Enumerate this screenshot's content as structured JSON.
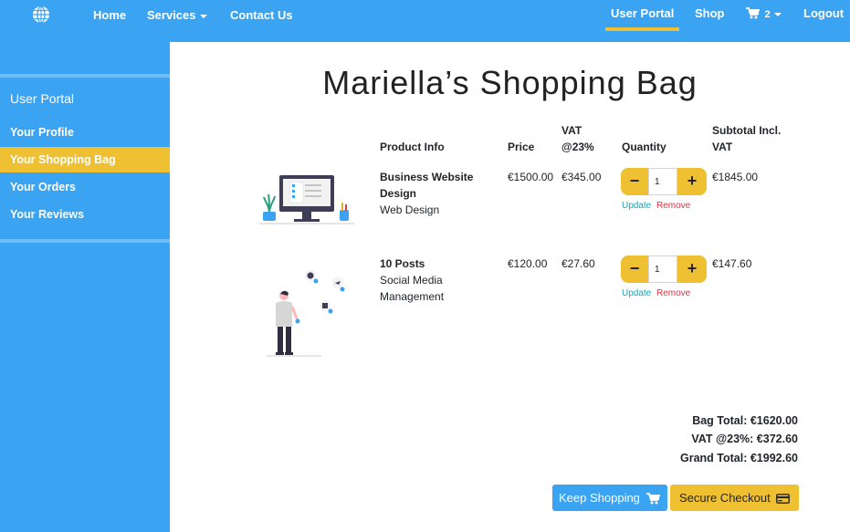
{
  "navbar": {
    "logo_icon": "globe-icon",
    "home": "Home",
    "services": "Services",
    "contact": "Contact Us",
    "user_portal": "User Portal",
    "shop": "Shop",
    "cart_count": "2",
    "cart_icon": "cart-icon",
    "logout": "Logout",
    "accent_color": "#efc032",
    "bar_color": "#3aa3f2"
  },
  "sidebar": {
    "title": "User Portal",
    "items": [
      {
        "label": "Your Profile",
        "active": false
      },
      {
        "label": "Your Shopping Bag",
        "active": true
      },
      {
        "label": "Your Orders",
        "active": false
      },
      {
        "label": "Your Reviews",
        "active": false
      }
    ]
  },
  "page": {
    "title": "Mariella’s Shopping Bag"
  },
  "table": {
    "headers": {
      "product_info": "Product Info",
      "price": "Price",
      "vat_line1": "VAT",
      "vat_line2": "@23%",
      "quantity": "Quantity",
      "subtotal_line1": "Subtotal Incl.",
      "subtotal_line2": "VAT"
    },
    "rows": [
      {
        "name_line1": "Business Website",
        "name_line2": "Design",
        "category": "Web Design",
        "price": "€1500.00",
        "vat": "€345.00",
        "quantity": "1",
        "subtotal": "€1845.00",
        "update": "Update",
        "remove": "Remove",
        "image_icon": "desktop-illustration"
      },
      {
        "name_line1": "10 Posts",
        "category_line1": "Social Media",
        "category_line2": "Management",
        "price": "€120.00",
        "vat": "€27.60",
        "quantity": "1",
        "subtotal": "€147.60",
        "update": "Update",
        "remove": "Remove",
        "image_icon": "social-media-illustration"
      }
    ]
  },
  "totals": {
    "bag_total": "Bag Total: €1620.00",
    "vat_total": "VAT @23%: €372.60",
    "grand_total": "Grand Total: €1992.60"
  },
  "buttons": {
    "keep_shopping": "Keep Shopping",
    "keep_shopping_icon": "cart-icon",
    "secure_checkout": "Secure Checkout",
    "secure_checkout_icon": "credit-card-icon"
  }
}
